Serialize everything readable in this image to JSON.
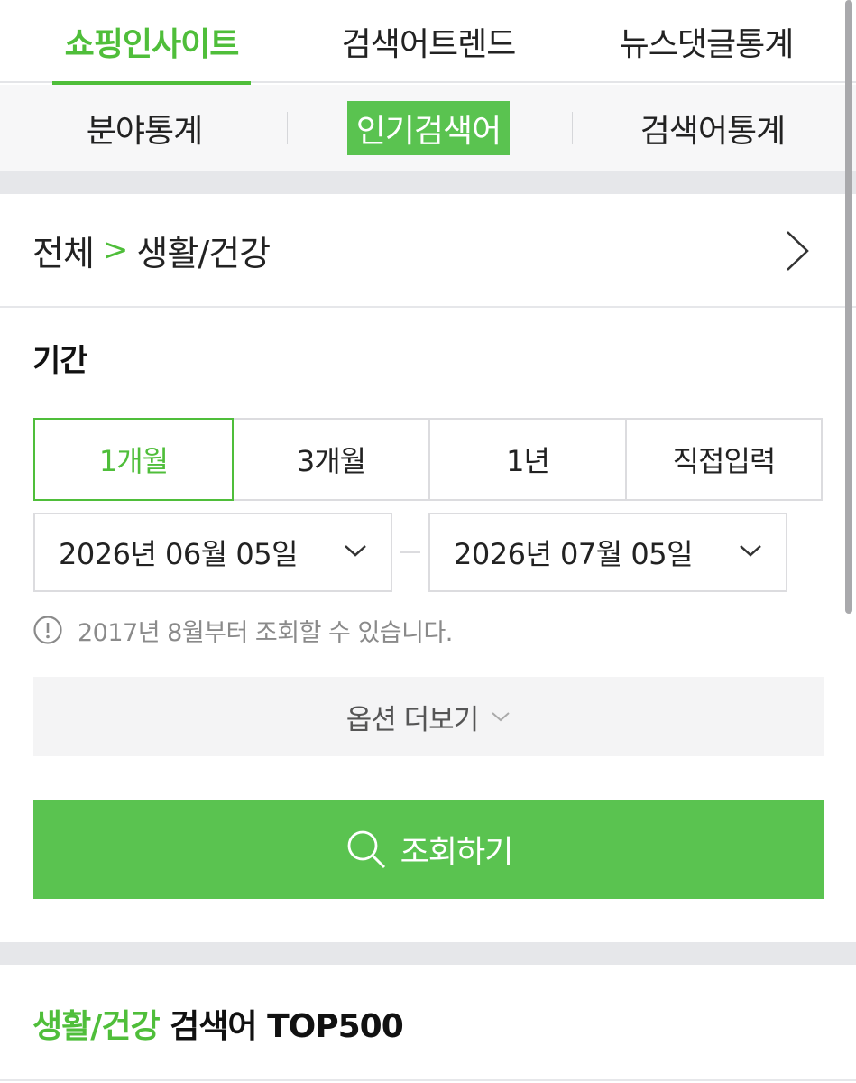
{
  "top_tabs": [
    {
      "label": "쇼핑인사이트",
      "active": true
    },
    {
      "label": "검색어트렌드",
      "active": false
    },
    {
      "label": "뉴스댓글통계",
      "active": false
    }
  ],
  "sub_tabs": [
    {
      "label": "분야통계",
      "active": false
    },
    {
      "label": "인기검색어",
      "active": true
    },
    {
      "label": "검색어통계",
      "active": false
    }
  ],
  "breadcrumb": {
    "root": "전체",
    "separator": ">",
    "current": "생활/건강"
  },
  "period": {
    "title": "기간",
    "options": [
      {
        "label": "1개월",
        "active": true
      },
      {
        "label": "3개월",
        "active": false
      },
      {
        "label": "1년",
        "active": false
      },
      {
        "label": "직접입력",
        "active": false
      }
    ],
    "start_date": "2026년 06월 05일",
    "end_date": "2026년 07월 05일",
    "notice": "2017년 8월부터 조회할 수 있습니다."
  },
  "more_options_label": "옵션 더보기",
  "search_button_label": "조회하기",
  "result_header": {
    "category": "생활/건강",
    "suffix": " 검색어 TOP500"
  },
  "colors": {
    "accent": "#4fbe3a",
    "button": "#5ac350"
  },
  "icons": {
    "breadcrumb_arrow": "chevron-right-icon",
    "date_dropdown": "chevron-down-icon",
    "notice": "info-icon",
    "search": "search-icon"
  }
}
